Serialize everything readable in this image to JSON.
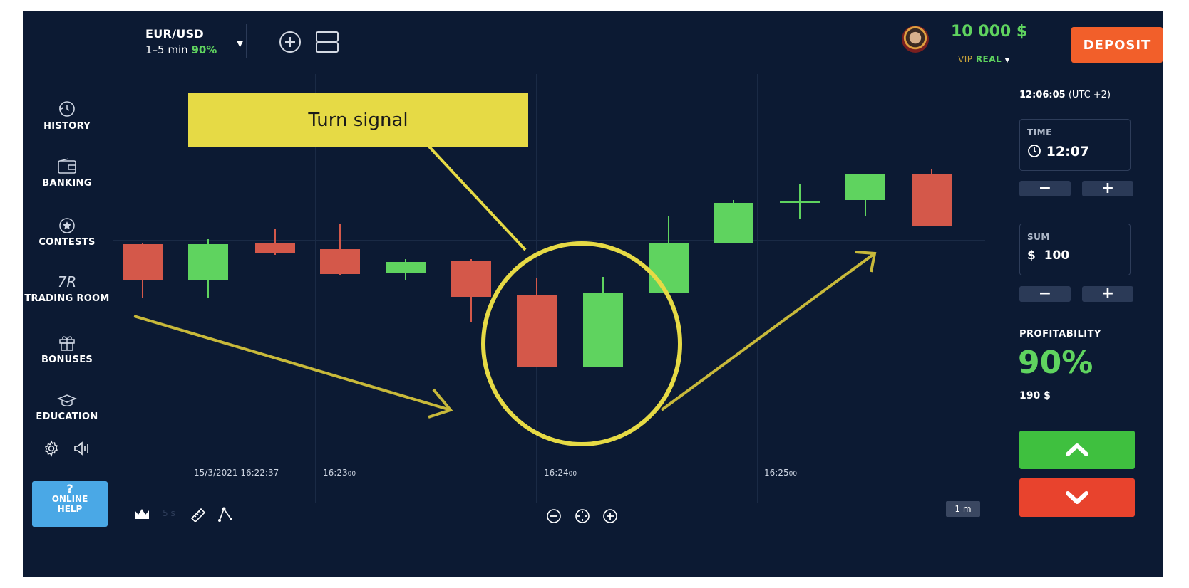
{
  "header": {
    "pair": "EUR/USD",
    "expiry": "1–5 min",
    "payout": "90%",
    "balance": "10 000 $",
    "account_vip": "VIP",
    "account_type": "REAL",
    "deposit_label": "DEPOSIT"
  },
  "sidebar": {
    "items": [
      {
        "label": "HISTORY",
        "icon": "history-icon"
      },
      {
        "label": "BANKING",
        "icon": "wallet-icon"
      },
      {
        "label": "CONTESTS",
        "icon": "star-icon"
      },
      {
        "label": "TRADING ROOM",
        "icon": "tr-logo-icon",
        "icon_text": "7R"
      },
      {
        "label": "BONUSES",
        "icon": "gift-icon"
      },
      {
        "label": "EDUCATION",
        "icon": "graduation-cap-icon"
      }
    ],
    "help_q": "?",
    "help_line1": "ONLINE",
    "help_line2": "HELP"
  },
  "chart": {
    "time_labels": [
      {
        "main": "15/3/2021 16:22:37",
        "sec": ""
      },
      {
        "main": "16:23",
        "sec": "00"
      },
      {
        "main": "16:24",
        "sec": "00"
      },
      {
        "main": "16:25",
        "sec": "00"
      }
    ],
    "bottom_left_interval": "5 s",
    "timeframe": "1 m",
    "annotation": "Turn signal"
  },
  "panel": {
    "server_time": "12:06:05",
    "timezone": "(UTC +2)",
    "time_caption": "TIME",
    "time_value": "12:07",
    "sum_caption": "SUM",
    "sum_currency": "$",
    "sum_value": "100",
    "profit_caption": "PROFITABILITY",
    "profit_value": "90%",
    "profit_amount": "190 $"
  },
  "colors": {
    "background": "#0c1a33",
    "up": "#5fd35f",
    "down": "#d4584a",
    "deposit": "#f25f2a",
    "call_button": "#3fc03f",
    "put_button": "#e8432d",
    "annotation": "#e6da45"
  }
}
